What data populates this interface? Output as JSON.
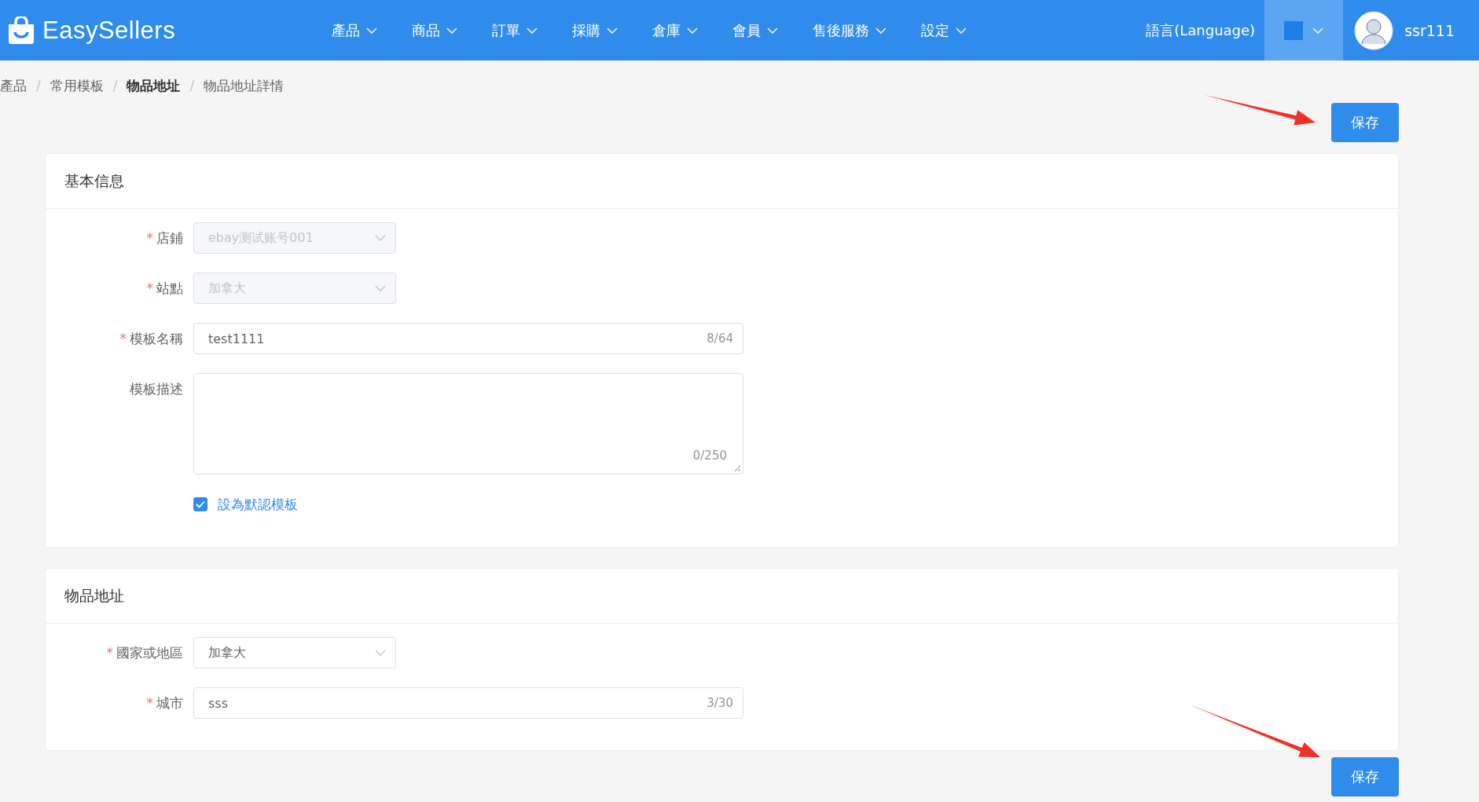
{
  "header": {
    "logo": "EasySellers",
    "nav": [
      {
        "label": "產品"
      },
      {
        "label": "商品"
      },
      {
        "label": "訂單"
      },
      {
        "label": "採購"
      },
      {
        "label": "倉庫"
      },
      {
        "label": "會員"
      },
      {
        "label": "售後服務"
      },
      {
        "label": "設定"
      }
    ],
    "language": "語言(Language)",
    "username": "ssr111"
  },
  "breadcrumb": [
    {
      "label": "產品",
      "emphasized": false
    },
    {
      "separator": "/",
      "label": "常用模板",
      "emphasized": false
    },
    {
      "separator": "/",
      "label": "物品地址",
      "emphasized": true
    },
    {
      "separator": "/",
      "label": "物品地址詳情",
      "emphasized": false
    }
  ],
  "save_top": "保存",
  "sections": [
    {
      "title": "基本信息",
      "fields": [
        {
          "kind": "select",
          "required_mark": "*",
          "label": "店鋪",
          "disabled": true,
          "value": "ebay测试账号001"
        },
        {
          "kind": "select",
          "required_mark": "*",
          "label": "站點",
          "disabled": true,
          "value": "加拿大"
        },
        {
          "kind": "input",
          "required_mark": "*",
          "label": "模板名稱",
          "disabled": false,
          "value": "test1111",
          "counter": "8/64"
        },
        {
          "kind": "textarea",
          "label": "模板描述",
          "counter": "0/250"
        },
        {
          "kind": "checkbox",
          "label": "設為默認模板",
          "checked": true
        }
      ]
    },
    {
      "title": "物品地址",
      "fields": [
        {
          "kind": "select",
          "required_mark": "*",
          "label": "國家或地區",
          "disabled": false,
          "value": "加拿大"
        },
        {
          "kind": "input",
          "required_mark": "*",
          "label": "城市",
          "disabled": false,
          "value": "sss",
          "counter": "3/30"
        }
      ]
    }
  ],
  "save_bottom": "保存"
}
